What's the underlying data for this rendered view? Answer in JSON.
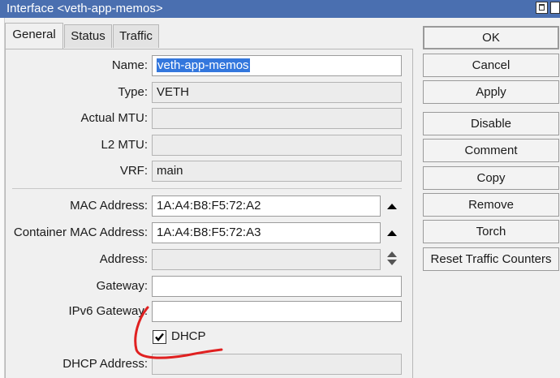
{
  "window": {
    "title": "Interface <veth-app-memos>"
  },
  "tabs": [
    {
      "label": "General",
      "active": true
    },
    {
      "label": "Status",
      "active": false
    },
    {
      "label": "Traffic",
      "active": false
    }
  ],
  "form": {
    "name": {
      "label": "Name:",
      "value": "veth-app-memos"
    },
    "type": {
      "label": "Type:",
      "value": "VETH"
    },
    "actual_mtu": {
      "label": "Actual MTU:",
      "value": ""
    },
    "l2_mtu": {
      "label": "L2 MTU:",
      "value": ""
    },
    "vrf": {
      "label": "VRF:",
      "value": "main"
    },
    "mac_address": {
      "label": "MAC Address:",
      "value": "1A:A4:B8:F5:72:A2"
    },
    "container_mac_address": {
      "label": "Container MAC Address:",
      "value": "1A:A4:B8:F5:72:A3"
    },
    "address": {
      "label": "Address:",
      "value": ""
    },
    "gateway": {
      "label": "Gateway:",
      "value": ""
    },
    "ipv6_gateway": {
      "label": "IPv6 Gateway:",
      "value": ""
    },
    "dhcp": {
      "label": "DHCP",
      "checked": true
    },
    "dhcp_address": {
      "label": "DHCP Address:",
      "value": ""
    }
  },
  "buttons": {
    "ok": "OK",
    "cancel": "Cancel",
    "apply": "Apply",
    "disable": "Disable",
    "comment": "Comment",
    "copy": "Copy",
    "remove": "Remove",
    "torch": "Torch",
    "reset_traffic_counters": "Reset Traffic Counters"
  },
  "colors": {
    "titlebar": "#4a6fb0",
    "selection": "#3377dd",
    "annotation": "#e02020"
  }
}
